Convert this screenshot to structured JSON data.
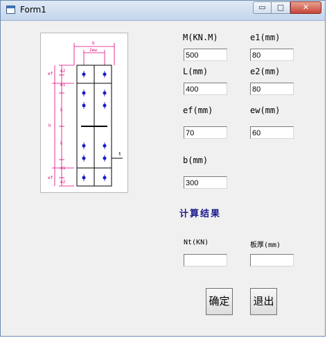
{
  "window": {
    "title": "Form1"
  },
  "titlebar": {
    "min_glyph": "▭",
    "max_glyph": "□",
    "close_glyph": "✕"
  },
  "fields": {
    "m": {
      "label": "M(KN.M)",
      "value": "500"
    },
    "e1": {
      "label": "e1(mm)",
      "value": "80"
    },
    "l": {
      "label": "L(mm)",
      "value": "400"
    },
    "e2": {
      "label": "e2(mm)",
      "value": "80"
    },
    "ef": {
      "label": "ef(mm)",
      "value": "70"
    },
    "ew": {
      "label": "ew(mm)",
      "value": "60"
    },
    "b": {
      "label": "b(mm)",
      "value": "300"
    }
  },
  "results": {
    "title": "计算结果",
    "nt": {
      "label": "Nt(KN)",
      "value": ""
    },
    "thk": {
      "label": "板厚(mm)",
      "value": ""
    }
  },
  "buttons": {
    "ok": "确定",
    "exit": "退出"
  },
  "drawing": {
    "top_dim_b": "b",
    "top_dim_2ew": "2ew",
    "left_dim_h": "h",
    "right_labels": [
      "e2",
      "e1",
      "L",
      "L",
      "e1",
      "e2"
    ],
    "left_labels": [
      "ef",
      "ef"
    ],
    "plate_label": "t"
  },
  "colors": {
    "dimension": "#e0007a",
    "bolt": "#1a1acc",
    "accent_title": "#1a1a8c"
  }
}
